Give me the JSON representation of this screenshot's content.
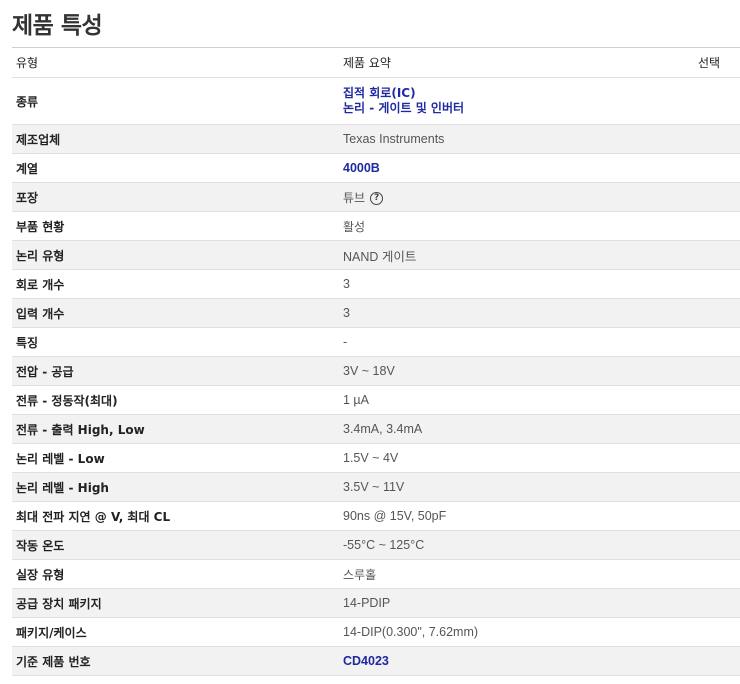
{
  "page_title": "제품 특성",
  "header": {
    "type": "유형",
    "summary": "제품 요약",
    "select": "선택"
  },
  "rows": [
    {
      "label": "종류",
      "value_lines": [
        "집적 회로(IC)",
        "논리 - 게이트 및 인버터"
      ],
      "link": true
    },
    {
      "label": "제조업체",
      "value": "Texas Instruments"
    },
    {
      "label": "계열",
      "value": "4000B",
      "link": true
    },
    {
      "label": "포장",
      "value": "튜브",
      "help_icon": "question-circle-icon"
    },
    {
      "label": "부품 현황",
      "value": "활성"
    },
    {
      "label": "논리 유형",
      "value": "NAND 게이트"
    },
    {
      "label": "회로 개수",
      "value": "3"
    },
    {
      "label": "입력 개수",
      "value": "3"
    },
    {
      "label": "특징",
      "value": "-"
    },
    {
      "label": "전압 - 공급",
      "value": "3V ~ 18V"
    },
    {
      "label": "전류 - 정동작(최대)",
      "value": "1 µA"
    },
    {
      "label": "전류 - 출력 High, Low",
      "value": "3.4mA, 3.4mA"
    },
    {
      "label": "논리 레벨 - Low",
      "value": "1.5V ~ 4V"
    },
    {
      "label": "논리 레벨 - High",
      "value": "3.5V ~ 11V"
    },
    {
      "label": "최대 전파 지연 @ V, 최대 CL",
      "value": "90ns @ 15V, 50pF"
    },
    {
      "label": "작동 온도",
      "value": "-55°C ~ 125°C"
    },
    {
      "label": "실장 유형",
      "value": "스루홀"
    },
    {
      "label": "공급 장치 패키지",
      "value": "14-PDIP"
    },
    {
      "label": "패키지/케이스",
      "value": "14-DIP(0.300\", 7.62mm)"
    },
    {
      "label": "기준 제품 번호",
      "value": "CD4023",
      "link": true
    }
  ],
  "colors": {
    "link": "#1f2aa0",
    "alt_row": "#f2f2f2",
    "border": "#e0e0e0"
  }
}
